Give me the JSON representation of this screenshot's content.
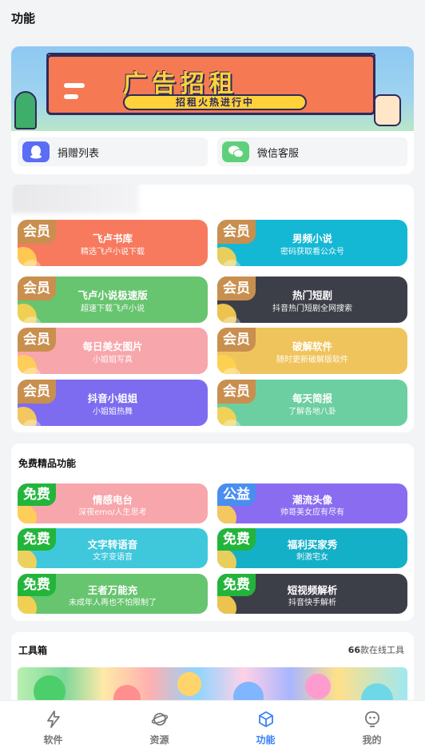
{
  "page_title": "功能",
  "banner": {
    "headline": "广告招租",
    "subline": "招租火热进行中"
  },
  "quick_links": [
    {
      "label": "捐赠列表",
      "icon": "qq-penguin-icon",
      "color": "#5b6cf5"
    },
    {
      "label": "微信客服",
      "icon": "wechat-icon",
      "color": "#5fd07a"
    }
  ],
  "member_badge": "会员",
  "member_tiles": [
    {
      "title": "飞卢书库",
      "desc": "精选飞卢小说下载",
      "color": "#f77a5f"
    },
    {
      "title": "男频小说",
      "desc": "密码获取看公众号",
      "color": "#14b8d4"
    },
    {
      "title": "飞卢小说极速版",
      "desc": "超速下载飞卢小说",
      "color": "#67c46f"
    },
    {
      "title": "热门短剧",
      "desc": "抖音热门短剧全网搜索",
      "color": "#3d3f48"
    },
    {
      "title": "每日美女图片",
      "desc": "小姐姐写真",
      "color": "#f7a6ab"
    },
    {
      "title": "破解软件",
      "desc": "随时更新破解版软件",
      "color": "#f0c45c"
    },
    {
      "title": "抖音小姐姐",
      "desc": "小姐姐热舞",
      "color": "#7d6cf0"
    },
    {
      "title": "每天简报",
      "desc": "了解各地八卦",
      "color": "#6ccfa2"
    }
  ],
  "free_section": {
    "title": "免费精品功能",
    "tiles": [
      {
        "badge": "免费",
        "title": "情感电台",
        "desc": "深夜emo/人生思考",
        "color": "#f7a6ab",
        "badge_color": "#23b53b"
      },
      {
        "badge": "公益",
        "title": "潮流头像",
        "desc": "帅哥美女应有尽有",
        "color": "#8a6cf0",
        "badge_color": "#4a8ef0"
      },
      {
        "badge": "免费",
        "title": "文字转语音",
        "desc": "文字变语音",
        "color": "#3fc8dc",
        "badge_color": "#23b53b"
      },
      {
        "badge": "免费",
        "title": "福利买家秀",
        "desc": "刺激宅女",
        "color": "#14b0c8",
        "badge_color": "#23b53b"
      },
      {
        "badge": "免费",
        "title": "王者万能充",
        "desc": "未成年人再也不怕限制了",
        "color": "#67c46f",
        "badge_color": "#23b53b"
      },
      {
        "badge": "免费",
        "title": "短视频解析",
        "desc": "抖音快手解析",
        "color": "#3d3f48",
        "badge_color": "#23b53b"
      }
    ]
  },
  "toolbox": {
    "title": "工具箱",
    "count": "66",
    "count_suffix": "款在线工具"
  },
  "nav": [
    {
      "label": "软件",
      "icon": "lightning-icon",
      "active": false
    },
    {
      "label": "资源",
      "icon": "planet-icon",
      "active": false
    },
    {
      "label": "功能",
      "icon": "cube-icon",
      "active": true
    },
    {
      "label": "我的",
      "icon": "profile-icon",
      "active": false
    }
  ],
  "colors": {
    "accent": "#3b82f6",
    "member_badge": "#c98f4f"
  }
}
